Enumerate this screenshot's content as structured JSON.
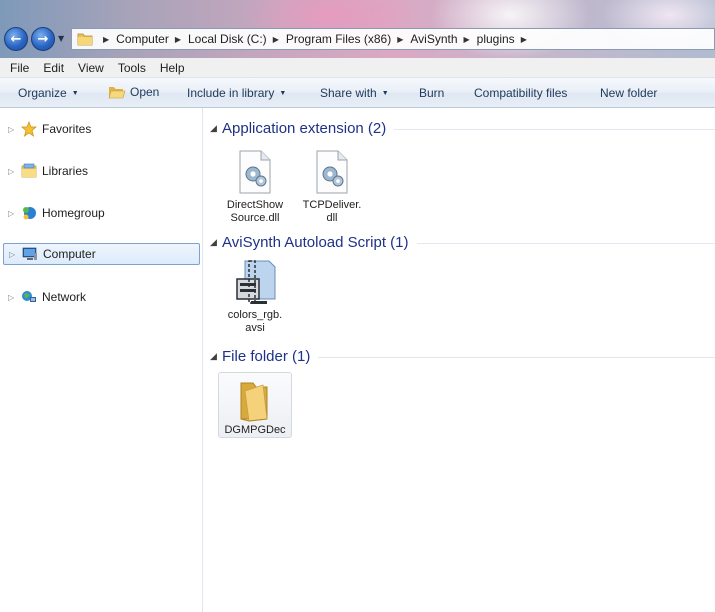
{
  "address": {
    "crumbs": [
      "Computer",
      "Local Disk (C:)",
      "Program Files (x86)",
      "AviSynth",
      "plugins"
    ]
  },
  "menu": [
    "File",
    "Edit",
    "View",
    "Tools",
    "Help"
  ],
  "commands": {
    "organize": "Organize",
    "open": "Open",
    "include_in_library": "Include in library",
    "share_with": "Share with",
    "burn": "Burn",
    "compatibility_files": "Compatibility files",
    "new_folder": "New folder"
  },
  "nav": {
    "items": [
      {
        "label": "Favorites",
        "icon": "star-icon"
      },
      {
        "label": "Libraries",
        "icon": "libraries-icon"
      },
      {
        "label": "Homegroup",
        "icon": "homegroup-icon"
      },
      {
        "label": "Computer",
        "icon": "computer-icon",
        "selected": true
      },
      {
        "label": "Network",
        "icon": "network-icon"
      }
    ]
  },
  "groups": [
    {
      "title": "Application extension (2)",
      "files": [
        {
          "name": "DirectShowSource.dll",
          "display": [
            "DirectShow",
            "Source.dll"
          ],
          "icon": "dll-icon"
        },
        {
          "name": "TCPDeliver.dll",
          "display": [
            "TCPDeliver.",
            "dll"
          ],
          "icon": "dll-icon"
        }
      ]
    },
    {
      "title": "AviSynth Autoload Script (1)",
      "files": [
        {
          "name": "colors_rgb.avsi",
          "display": [
            "colors_rgb.",
            "avsi"
          ],
          "icon": "avsi-script-icon"
        }
      ]
    },
    {
      "title": "File folder (1)",
      "files": [
        {
          "name": "DGMPGDec",
          "display": [
            "DGMPGDec"
          ],
          "icon": "folder-icon"
        }
      ]
    }
  ],
  "colors": {
    "group_title": "#1e3287",
    "command_text": "#1e395b",
    "selection_border": "#7da2ce"
  }
}
